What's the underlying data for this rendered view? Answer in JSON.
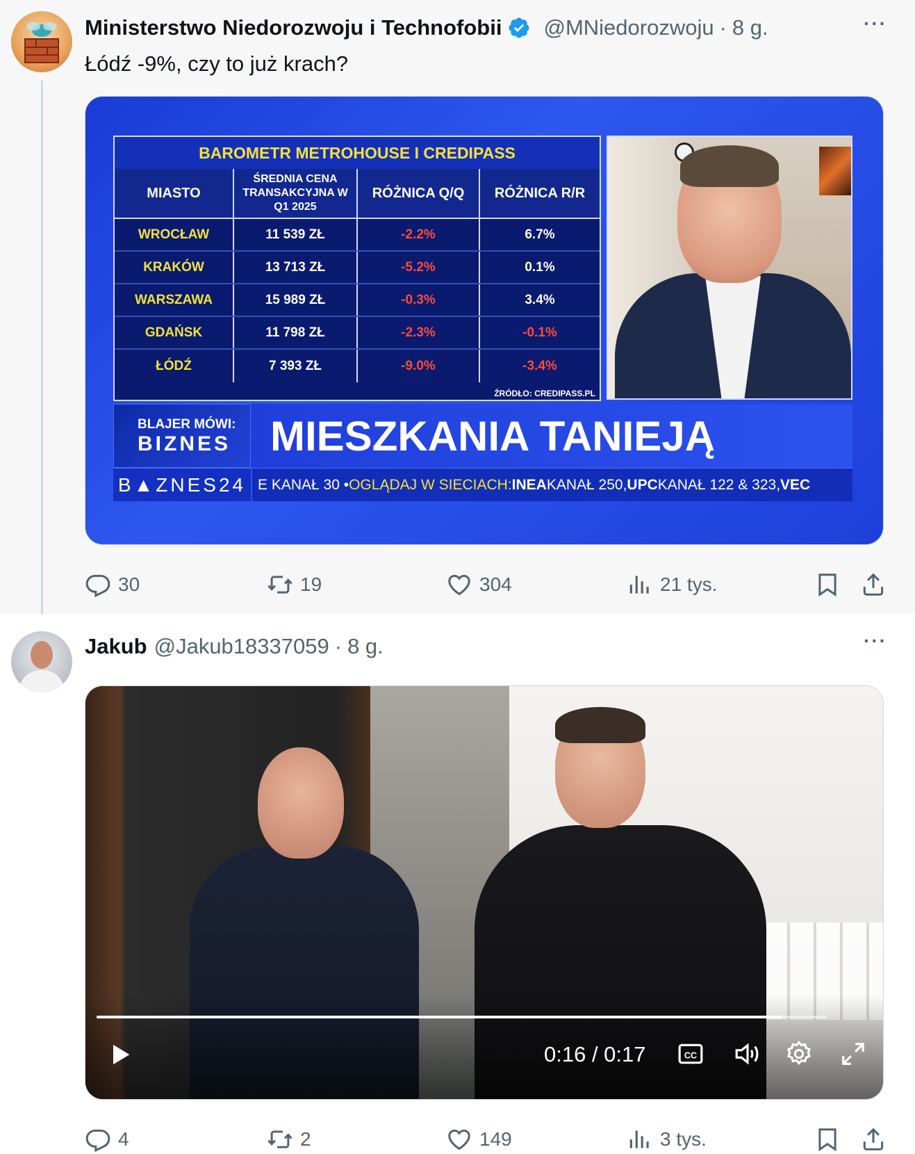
{
  "tweet1": {
    "author_name": "Ministerstwo Niedorozwoju i Technofobii",
    "handle": "@MNiedorozwoju",
    "separator": "·",
    "time": "8 g.",
    "more": "···",
    "text": "Łódź -9%, czy to już krach?",
    "media": {
      "table_title": "BAROMETR METROHOUSE I CREDIPASS",
      "columns": [
        "MIASTO",
        "ŚREDNIA CENA TRANSAKCYJNA W Q1 2025",
        "RÓŻNICA Q/Q",
        "RÓŻNICA R/R"
      ],
      "rows": [
        {
          "city": "WROCŁAW",
          "price": "11 539 ZŁ",
          "qq": "-2.2%",
          "rr": "6.7%"
        },
        {
          "city": "KRAKÓW",
          "price": "13 713 ZŁ",
          "qq": "-5.2%",
          "rr": "0.1%"
        },
        {
          "city": "WARSZAWA",
          "price": "15 989 ZŁ",
          "qq": "-0.3%",
          "rr": "3.4%"
        },
        {
          "city": "GDAŃSK",
          "price": "11 798 ZŁ",
          "qq": "-2.3%",
          "rr": "-0.1%"
        },
        {
          "city": "ŁÓDŹ",
          "price": "7 393 ZŁ",
          "qq": "-9.0%",
          "rr": "-3.4%"
        }
      ],
      "source": "ŹRÓDŁO: CREDIPASS.PL",
      "show_small": "BLAJER MÓWI:",
      "show_big": "BIZNES",
      "headline": "MIESZKANIA TANIEJĄ",
      "channel": "B▲ZNES24",
      "ticker_1": "E KANAŁ 30 • ",
      "ticker_2": "OGLĄDAJ W SIECIACH: ",
      "ticker_3": "INEA",
      "ticker_4": " KANAŁ 250, ",
      "ticker_5": "UPC",
      "ticker_6": " KANAŁ 122 & 323, ",
      "ticker_7": "VEC"
    },
    "actions": {
      "replies": "30",
      "retweets": "19",
      "likes": "304",
      "views": "21 tys."
    }
  },
  "tweet2": {
    "author_name": "Jakub",
    "handle": "@Jakub18337059",
    "separator": "·",
    "time": "8 g.",
    "more": "···",
    "video": {
      "time_display": "0:16 / 0:17",
      "progress": 0.94
    },
    "actions": {
      "replies": "4",
      "retweets": "2",
      "likes": "149",
      "views": "3 tys."
    }
  },
  "colors": {
    "verified": "#1d9bf0",
    "secondary_text": "#536471",
    "tv_blue": "#1d40d9",
    "tv_yellow": "#f5e23a",
    "tv_red": "#ff4a3a"
  },
  "icons": [
    "verified-badge-icon",
    "more-icon",
    "reply-icon",
    "retweet-icon",
    "like-icon",
    "views-icon",
    "bookmark-icon",
    "share-icon",
    "play-icon",
    "captions-icon",
    "volume-icon",
    "settings-icon",
    "fullscreen-icon"
  ]
}
